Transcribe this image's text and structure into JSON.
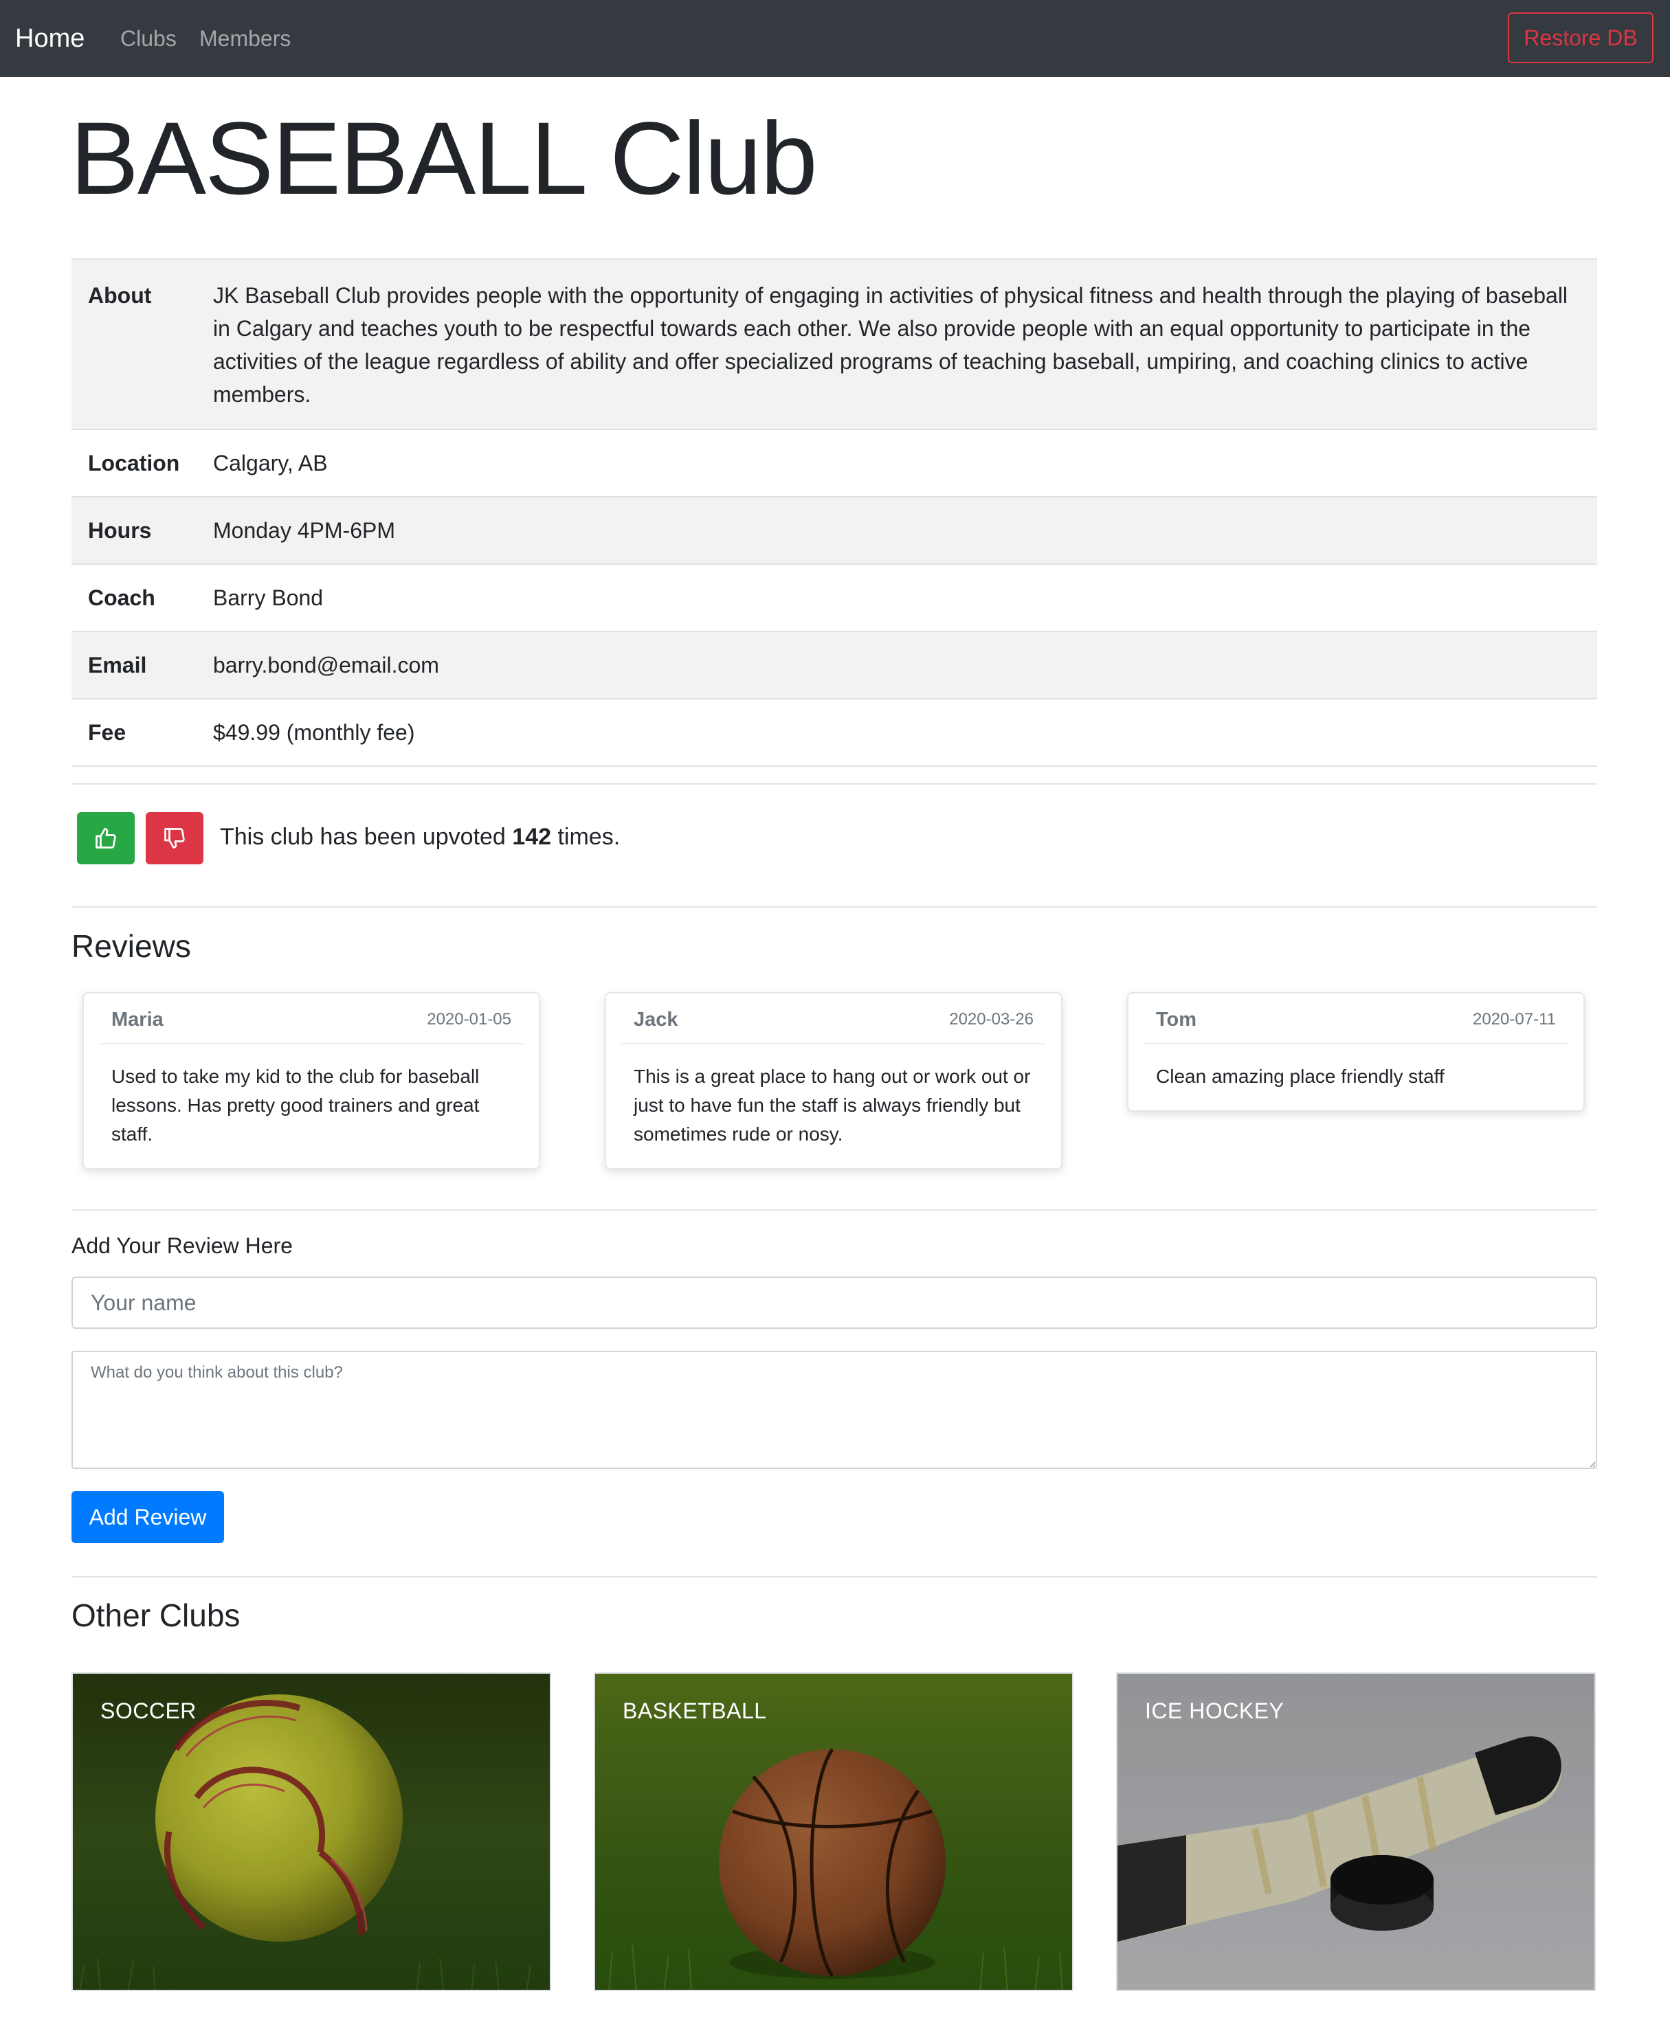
{
  "navbar": {
    "brand": "Home",
    "links": [
      "Clubs",
      "Members"
    ],
    "restore_button": "Restore DB"
  },
  "page_title": "BASEBALL Club",
  "club_info": [
    {
      "label": "About",
      "value": "JK Baseball Club provides people with the opportunity of engaging in activities of physical fitness and health through the playing of baseball in Calgary and teaches youth to be respectful towards each other. We also provide people with an equal opportunity to participate in the activities of the league regardless of ability and offer specialized programs of teaching baseball, umpiring, and coaching clinics to active members."
    },
    {
      "label": "Location",
      "value": "Calgary, AB"
    },
    {
      "label": "Hours",
      "value": "Monday 4PM-6PM"
    },
    {
      "label": "Coach",
      "value": "Barry Bond"
    },
    {
      "label": "Email",
      "value": "barry.bond@email.com"
    },
    {
      "label": "Fee",
      "value": "$49.99 (monthly fee)"
    }
  ],
  "votes": {
    "text_before": "This club has been upvoted ",
    "count": "142",
    "text_after": " times.",
    "upvote_icon": "thumbs-up-icon",
    "downvote_icon": "thumbs-down-icon",
    "upvote_color": "#28a745",
    "downvote_color": "#dc3545"
  },
  "reviews": {
    "heading": "Reviews",
    "items": [
      {
        "name": "Maria",
        "date": "2020-01-05",
        "text": "Used to take my kid to the club for baseball lessons. Has pretty good trainers and great staff."
      },
      {
        "name": "Jack",
        "date": "2020-03-26",
        "text": "This is a great place to hang out or work out or just to have fun the staff is always friendly but sometimes rude or nosy."
      },
      {
        "name": "Tom",
        "date": "2020-07-11",
        "text": "Clean amazing place friendly staff"
      }
    ]
  },
  "add_review": {
    "label": "Add Your Review Here",
    "name_placeholder": "Your name",
    "text_placeholder": "What do you think about this club?",
    "button": "Add Review",
    "button_color": "#007bff"
  },
  "other_clubs": {
    "heading": "Other Clubs",
    "items": [
      {
        "name": "SOCCER",
        "image": "soccer-ball-on-grass"
      },
      {
        "name": "BASKETBALL",
        "image": "basketball-on-grass"
      },
      {
        "name": "ICE HOCKEY",
        "image": "hockey-stick-and-puck"
      }
    ]
  },
  "colors": {
    "navbar_bg": "#343a40",
    "danger": "#dc3545",
    "success": "#28a745",
    "primary": "#007bff"
  }
}
